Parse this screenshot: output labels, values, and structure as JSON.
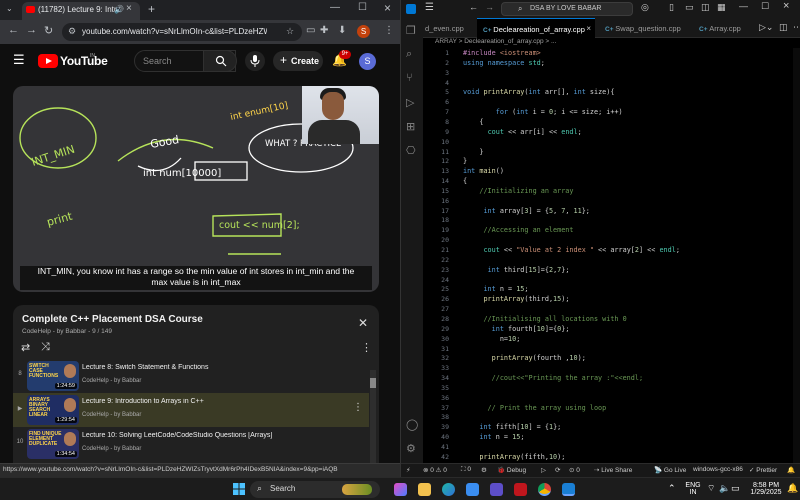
{
  "browser": {
    "tab_title": "(11782) Lecture 9: Introduc",
    "url": "youtube.com/watch?v=sNrLlmOIn-c&list=PLDzeHZWIZs...",
    "status_url": "https://www.youtube.com/watch?v=sNrLlmOIn-c&list=PLDzeHZWIZsTryvtXdMr6rPh4IDexB5NIA&index=9&pp=iAQB",
    "profile_initial": "S"
  },
  "youtube": {
    "logo_text": "YouTube",
    "logo_region": "IN",
    "search_placeholder": "Search",
    "create_label": "Create",
    "notif_count": "9+",
    "avatar_initial": "S",
    "caption_line1": "INT_MIN,  you know int has a range so the min value of int stores in int_min and the",
    "caption_line2": "max value is in int_max",
    "whiteboard": {
      "w1": "INT_MIN",
      "w2": "Good",
      "w3": "int num[10000]",
      "w4": "WHAT ? PRACTICE",
      "w5": "cout << num[2];",
      "w6": "print",
      "w7": "int enum[10]"
    }
  },
  "playlist": {
    "title": "Complete C++ Placement DSA Course",
    "subtitle": "CodeHelp - by Babbar - 9 / 149",
    "items": [
      {
        "num": "8",
        "title": "Lecture 8: Switch Statement & Functions",
        "by": "CodeHelp - by Babbar",
        "thumb": "SWITCH CASE FUNCTIONS",
        "duration": "1:24:59",
        "thumb_color": "#233c6e"
      },
      {
        "num": "▶",
        "title": "Lecture 9: Introduction to Arrays in C++",
        "by": "CodeHelp - by Babbar",
        "thumb": "ARRAYS BINARY SEARCH LINEAR",
        "duration": "1:29:54",
        "thumb_color": "#1f2d63"
      },
      {
        "num": "10",
        "title": "Lecture 10: Solving LeetCode/CodeStudio Questions [Arrays]",
        "by": "CodeHelp - by Babbar",
        "thumb": "FIND UNIQUE ELEMENT DUPLICATE",
        "duration": "1:34:54",
        "thumb_color": "#2a2f66"
      }
    ]
  },
  "vscode": {
    "search_text": "DSA BY LOVE BABAR",
    "tabs": [
      {
        "label": "d_even.cpp"
      },
      {
        "label": "Decleareation_of_array.cpp",
        "active": true
      },
      {
        "label": "Swap_question.cpp"
      },
      {
        "label": "Array.cpp"
      }
    ],
    "breadcrumb": "ARRAY > Decleareation_of_array.cpp > ...",
    "lines": [
      {
        "n": "1",
        "t": "#include <iostream>"
      },
      {
        "n": "2",
        "t": "using namespace std;"
      },
      {
        "n": "3",
        "t": ""
      },
      {
        "n": "4",
        "t": ""
      },
      {
        "n": "5",
        "t": "void printArray(int arr[], int size){"
      },
      {
        "n": "6",
        "t": ""
      },
      {
        "n": "7",
        "t": "        for (int i = 0; i <= size; i++)"
      },
      {
        "n": "8",
        "t": "    {"
      },
      {
        "n": "9",
        "t": "      cout << arr[i] << endl;"
      },
      {
        "n": "10",
        "t": ""
      },
      {
        "n": "11",
        "t": "    }"
      },
      {
        "n": "12",
        "t": "}"
      },
      {
        "n": "13",
        "t": "int main()"
      },
      {
        "n": "14",
        "t": "{"
      },
      {
        "n": "15",
        "t": "    //Initializing an array"
      },
      {
        "n": "16",
        "t": ""
      },
      {
        "n": "17",
        "t": "     int array[3] = {5, 7, 11};"
      },
      {
        "n": "18",
        "t": ""
      },
      {
        "n": "19",
        "t": "     //Accessing an element"
      },
      {
        "n": "20",
        "t": ""
      },
      {
        "n": "21",
        "t": "     cout << \"Value at 2 index \" << array[2] << endl;"
      },
      {
        "n": "22",
        "t": ""
      },
      {
        "n": "23",
        "t": "      int third[15]={2,7};"
      },
      {
        "n": "24",
        "t": ""
      },
      {
        "n": "25",
        "t": "     int n = 15;"
      },
      {
        "n": "26",
        "t": "     printArray(third,15);"
      },
      {
        "n": "27",
        "t": ""
      },
      {
        "n": "28",
        "t": "     //Initialising all locations with 0"
      },
      {
        "n": "29",
        "t": "       int fourth[10]={0};"
      },
      {
        "n": "30",
        "t": "         n=10;"
      },
      {
        "n": "31",
        "t": ""
      },
      {
        "n": "32",
        "t": "       printArray(fourth ,10);"
      },
      {
        "n": "33",
        "t": ""
      },
      {
        "n": "34",
        "t": "       //cout<<\"Printing the array :\"<<endl;"
      },
      {
        "n": "35",
        "t": ""
      },
      {
        "n": "36",
        "t": ""
      },
      {
        "n": "37",
        "t": "      // Print the array using loop"
      },
      {
        "n": "38",
        "t": ""
      },
      {
        "n": "39",
        "t": "    int fifth[10] = {1};"
      },
      {
        "n": "40",
        "t": "    int n = 15;"
      },
      {
        "n": "41",
        "t": ""
      },
      {
        "n": "42",
        "t": "    printArray(fifth,10);"
      }
    ],
    "status": {
      "errors": "⊗ 0 ⚠ 0",
      "warnings": "⚠ 0",
      "debug": "Debug",
      "live_share": "Live Share",
      "go_live": "Go Live",
      "compiler": "windows-gcc-x86",
      "prettier": "Prettier"
    }
  },
  "taskbar": {
    "search_label": "Search",
    "lang": "ENG",
    "region": "IN",
    "time": "8:58 PM",
    "date": "1/29/2025"
  },
  "colors": {
    "yt_red": "#ff0000",
    "vs_accent": "#0078d4",
    "keyword": "#569cd6",
    "comment": "#6a9955",
    "string": "#ce9178",
    "number": "#b5cea8",
    "function": "#dcdcaa",
    "preproc": "#c586c0"
  }
}
